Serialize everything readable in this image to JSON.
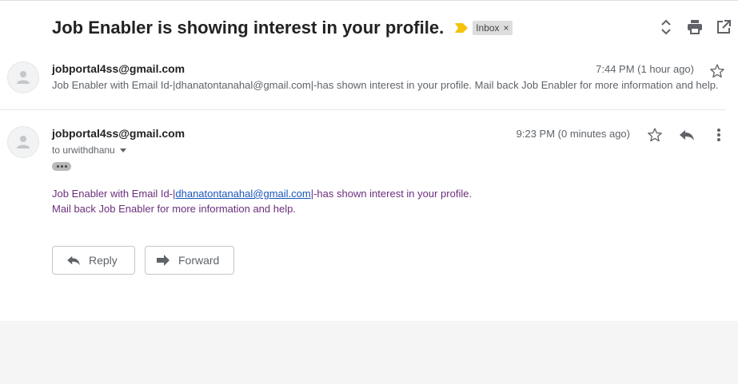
{
  "thread": {
    "subject": "Job Enabler is showing interest in your profile.",
    "label": "Inbox",
    "label_remove": "×"
  },
  "messages": [
    {
      "sender": "jobportal4ss@gmail.com",
      "time": "7:44 PM (1 hour ago)",
      "snippet": "Job Enabler with Email Id-|dhanatontanahal@gmail.com|-has shown interest in your profile. Mail back Job Enabler for more information and help."
    },
    {
      "sender": "jobportal4ss@gmail.com",
      "to": "to urwithdhanu",
      "time": "9:23 PM (0 minutes ago)",
      "body_line1_prefix": "Job Enabler with Email Id-|",
      "body_email": "dhanatontanahal@gmail.com",
      "body_line1_suffix": "|-has shown interest in your profile.",
      "body_line2": "Mail back Job Enabler for more information and help."
    }
  ],
  "actions": {
    "reply_label": "Reply",
    "forward_label": "Forward"
  },
  "icons": {
    "importance": "importance-marker-icon",
    "expand": "expand-collapse-icon",
    "print": "print-icon",
    "open_new_window": "open-in-new-window-icon",
    "star": "star-icon",
    "reply": "reply-icon",
    "more": "more-vertical-icon",
    "avatar": "person-icon"
  },
  "colors": {
    "importance": "#f4c20d",
    "body_text": "#6b2f7c",
    "link": "#1a56b9"
  }
}
